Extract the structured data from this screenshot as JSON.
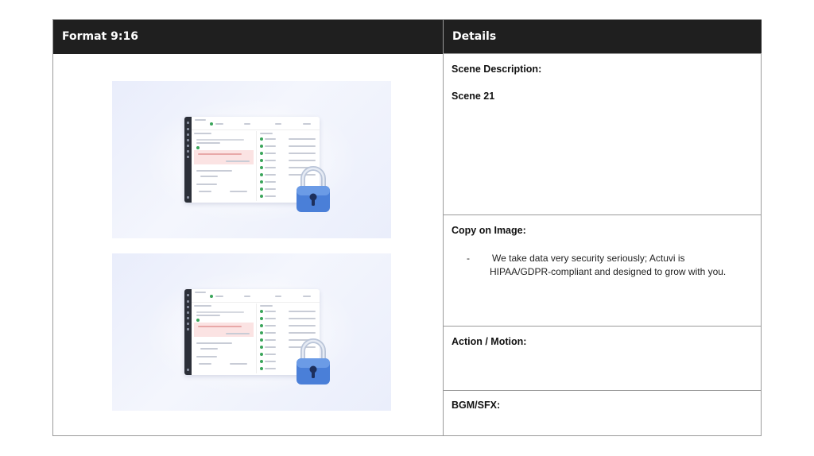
{
  "table": {
    "left_header": "Format 9:16",
    "right_header": "Details"
  },
  "details": {
    "scene_description_label": "Scene Description:",
    "scene_number": "Scene 21",
    "copy_label": "Copy on Image:",
    "copy_bullet": "-",
    "copy_line1": "We take data very security seriously; Actuvi is",
    "copy_line2": "HIPAA/GDPR-compliant and designed to grow with you.",
    "action_label": "Action / Motion:",
    "bgm_label": "BGM/SFX:"
  },
  "frames": [
    {
      "icon": "padlock-icon"
    },
    {
      "icon": "padlock-icon"
    }
  ],
  "colors": {
    "header_bg": "#1f1f1f",
    "border": "#9a9a9a",
    "lock_blue": "#4a7fd8"
  }
}
